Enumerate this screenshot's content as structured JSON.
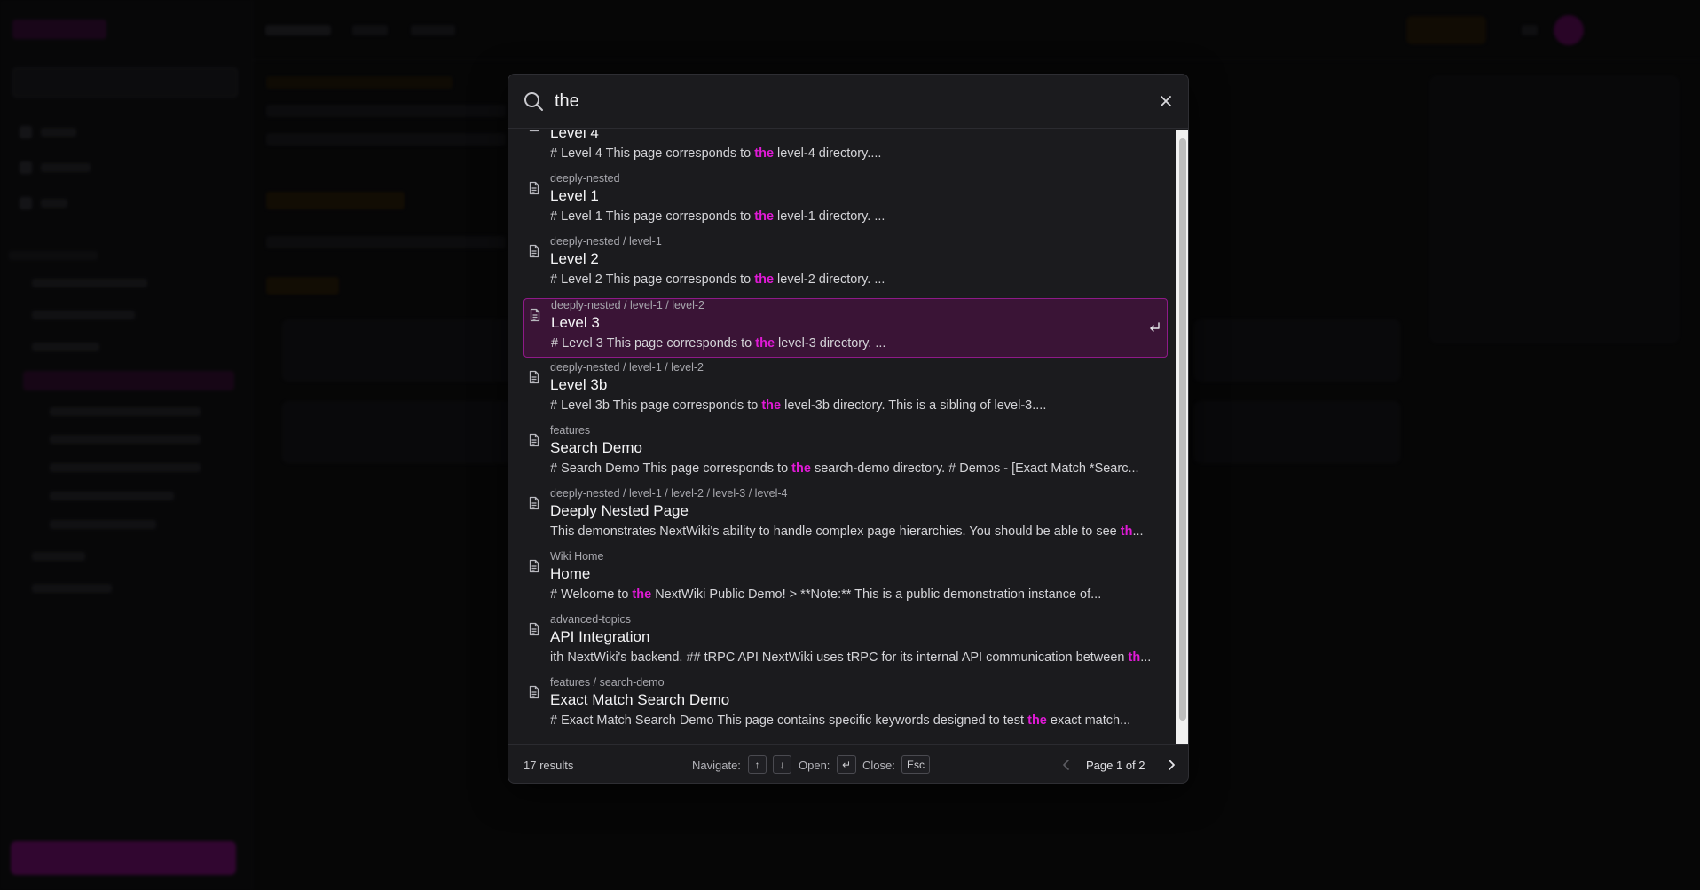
{
  "search": {
    "query": "the",
    "placeholder": ""
  },
  "results": [
    {
      "breadcrumb": "",
      "title": "Level 4",
      "snippet_before": "# Level 4 This page corresponds to ",
      "snippet_match": "the",
      "snippet_after": " level-4 directory....",
      "selected": false
    },
    {
      "breadcrumb": "deeply-nested",
      "title": "Level 1",
      "snippet_before": "# Level 1 This page corresponds to ",
      "snippet_match": "the",
      "snippet_after": " level-1 directory. ...",
      "selected": false
    },
    {
      "breadcrumb": "deeply-nested / level-1",
      "title": "Level 2",
      "snippet_before": "# Level 2 This page corresponds to ",
      "snippet_match": "the",
      "snippet_after": " level-2 directory. ...",
      "selected": false
    },
    {
      "breadcrumb": "deeply-nested / level-1 / level-2",
      "title": "Level 3",
      "snippet_before": "# Level 3 This page corresponds to ",
      "snippet_match": "the",
      "snippet_after": " level-3 directory. ...",
      "selected": true
    },
    {
      "breadcrumb": "deeply-nested / level-1 / level-2",
      "title": "Level 3b",
      "snippet_before": "# Level 3b This page corresponds to ",
      "snippet_match": "the",
      "snippet_after": " level-3b directory. This is a sibling of level-3....",
      "selected": false
    },
    {
      "breadcrumb": "features",
      "title": "Search Demo",
      "snippet_before": "# Search Demo This page corresponds to ",
      "snippet_match": "the",
      "snippet_after": " search-demo directory. # Demos - [Exact Match *Searc...",
      "selected": false
    },
    {
      "breadcrumb": "deeply-nested / level-1 / level-2 / level-3 / level-4",
      "title": "Deeply Nested Page",
      "snippet_before": "This demonstrates NextWiki's ability to handle complex page hierarchies. You should be able to see ",
      "snippet_match": "th",
      "snippet_after": "...",
      "selected": false
    },
    {
      "breadcrumb": "Wiki Home",
      "title": "Home",
      "snippet_before": "# Welcome to ",
      "snippet_match": "the",
      "snippet_after": " NextWiki Public Demo! > **Note:** This is a public demonstration instance of...",
      "selected": false
    },
    {
      "breadcrumb": "advanced-topics",
      "title": "API Integration",
      "snippet_before": "ith NextWiki's backend. ## tRPC API NextWiki uses tRPC for its internal API communication between ",
      "snippet_match": "th",
      "snippet_after": "...",
      "selected": false
    },
    {
      "breadcrumb": "features / search-demo",
      "title": "Exact Match Search Demo",
      "snippet_before": "# Exact Match Search Demo This page contains specific keywords designed to test ",
      "snippet_match": "the",
      "snippet_after": " exact match...",
      "selected": false
    }
  ],
  "footer": {
    "count": "17 results",
    "navigate_label": "Navigate:",
    "key_up": "↑",
    "key_down": "↓",
    "open_label": "Open:",
    "key_enter": "↵",
    "close_label": "Close:",
    "key_esc": "Esc",
    "page_text": "Page 1 of 2"
  },
  "colors": {
    "highlight": "#e01ad6",
    "selected_border": "#8e1a88",
    "selected_bg": "#3a1436",
    "dialog_bg": "#1b1b1e"
  },
  "icons": {
    "search": "search-icon",
    "close": "close-icon",
    "document": "document-icon",
    "enter": "enter-icon",
    "prev": "chevron-left-icon",
    "next": "chevron-right-icon"
  }
}
